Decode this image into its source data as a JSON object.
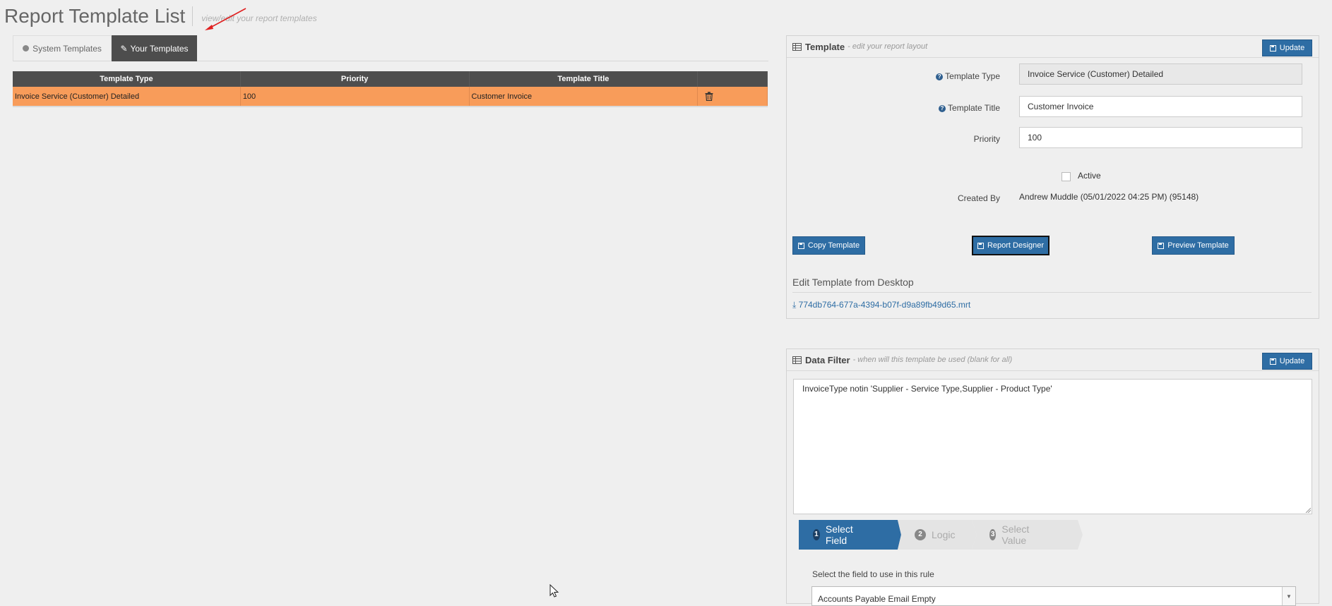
{
  "header": {
    "title": "Report Template List",
    "subtitle": "view/edit your report templates"
  },
  "tabs": [
    {
      "label": "System Templates",
      "active": false
    },
    {
      "label": "Your Templates",
      "active": true
    }
  ],
  "table": {
    "columns": [
      "Template Type",
      "Priority",
      "Template Title"
    ],
    "rows": [
      {
        "type": "Invoice Service (Customer) Detailed",
        "priority": "100",
        "title": "Customer Invoice"
      }
    ]
  },
  "template_panel": {
    "title": "Template",
    "subtitle": "- edit your report layout",
    "update_label": "Update",
    "fields": {
      "type_label": "Template Type",
      "type_value": "Invoice Service (Customer) Detailed",
      "title_label": "Template Title",
      "title_value": "Customer Invoice",
      "priority_label": "Priority",
      "priority_value": "100",
      "active_label": "Active",
      "active_checked": false,
      "created_by_label": "Created By",
      "created_by_value": "Andrew Muddle (05/01/2022 04:25 PM) (95148)"
    },
    "buttons": {
      "copy": "Copy Template",
      "designer": "Report Designer",
      "preview": "Preview Template"
    },
    "desktop_section_title": "Edit Template from Desktop",
    "download_file": "774db764-677a-4394-b07f-d9a89fb49d65.mrt"
  },
  "filter_panel": {
    "title": "Data Filter",
    "subtitle": "- when will this template be used (blank for all)",
    "update_label": "Update",
    "filter_text": "InvoiceType notin 'Supplier - Service Type,Supplier - Product Type'",
    "wizard_steps": [
      {
        "num": "1",
        "label": "Select Field",
        "active": true
      },
      {
        "num": "2",
        "label": "Logic",
        "active": false
      },
      {
        "num": "3",
        "label": "Select Value",
        "active": false
      }
    ],
    "field_hint": "Select the field to use in this rule",
    "field_selected": "Accounts Payable Email Empty"
  },
  "colors": {
    "primary": "#2e6da4",
    "row_highlight": "#f89c5a",
    "table_header": "#4e4e4e",
    "tab_active": "#4d4d4d"
  },
  "icons": [
    "circle-icon",
    "pencil-icon",
    "trash-icon",
    "grid-icon",
    "save-icon",
    "question-icon",
    "download-icon"
  ]
}
